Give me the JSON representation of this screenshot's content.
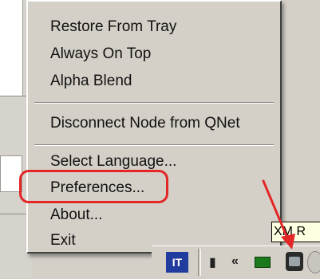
{
  "menu": {
    "items": [
      {
        "label": "Restore From Tray"
      },
      {
        "label": "Always On Top"
      },
      {
        "label": "Alpha Blend"
      },
      {
        "label": "Disconnect Node from QNet"
      },
      {
        "label": "Select Language..."
      },
      {
        "label": "Preferences..."
      },
      {
        "label": "About..."
      },
      {
        "label": "Exit"
      }
    ],
    "highlighted_item": "Preferences..."
  },
  "tooltip": {
    "text": "XM R"
  },
  "tray": {
    "language_badge": "IT",
    "icons": [
      "printer-icon",
      "chevron-icon",
      "network-icon",
      "app-tray-icon",
      "clock-icon"
    ]
  },
  "colors": {
    "menu_bg": "#d4d0c8",
    "highlight_ring": "#e32626",
    "annotation_arrow": "#e32626",
    "tooltip_bg": "#ffffe1",
    "lang_badge_bg": "#1f3c9e"
  }
}
